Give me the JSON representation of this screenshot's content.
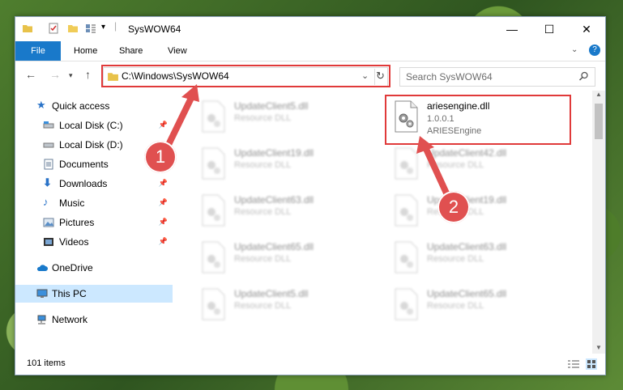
{
  "window": {
    "title": "SysWOW64"
  },
  "ribbon": {
    "tabs": [
      "File",
      "Home",
      "Share",
      "View"
    ]
  },
  "address": {
    "path": "C:\\Windows\\SysWOW64"
  },
  "search": {
    "placeholder": "Search SysWOW64"
  },
  "sidebar": {
    "items": [
      {
        "label": "Quick access"
      },
      {
        "label": "Local Disk (C:)"
      },
      {
        "label": "Local Disk (D:)"
      },
      {
        "label": "Documents"
      },
      {
        "label": "Downloads"
      },
      {
        "label": "Music"
      },
      {
        "label": "Pictures"
      },
      {
        "label": "Videos"
      },
      {
        "label": "OneDrive"
      },
      {
        "label": "This PC"
      },
      {
        "label": "Network"
      }
    ]
  },
  "files": {
    "highlighted": {
      "name": "ariesengine.dll",
      "version": "1.0.0.1",
      "desc": "ARIESEngine"
    },
    "left": [
      {
        "name": "UpdateClient5.dll",
        "desc": "Resource DLL"
      },
      {
        "name": "UpdateClient19.dll",
        "desc": "Resource DLL"
      },
      {
        "name": "UpdateClient63.dll",
        "desc": "Resource DLL"
      },
      {
        "name": "UpdateClient65.dll",
        "desc": "Resource DLL"
      },
      {
        "name": "UpdateClient5.dll",
        "desc": "Resource DLL"
      }
    ],
    "right": [
      {
        "name": "UpdateClient42.dll",
        "desc": "Resource DLL"
      },
      {
        "name": "UpdateClient19.dll",
        "desc": "Resource DLL"
      },
      {
        "name": "UpdateClient63.dll",
        "desc": "Resource DLL"
      },
      {
        "name": "UpdateClient65.dll",
        "desc": "Resource DLL"
      }
    ]
  },
  "status": {
    "count": "101 items"
  },
  "annotations": {
    "step1": "1",
    "step2": "2"
  },
  "colors": {
    "accent": "#1979ca",
    "highlight": "#e03a3a"
  }
}
